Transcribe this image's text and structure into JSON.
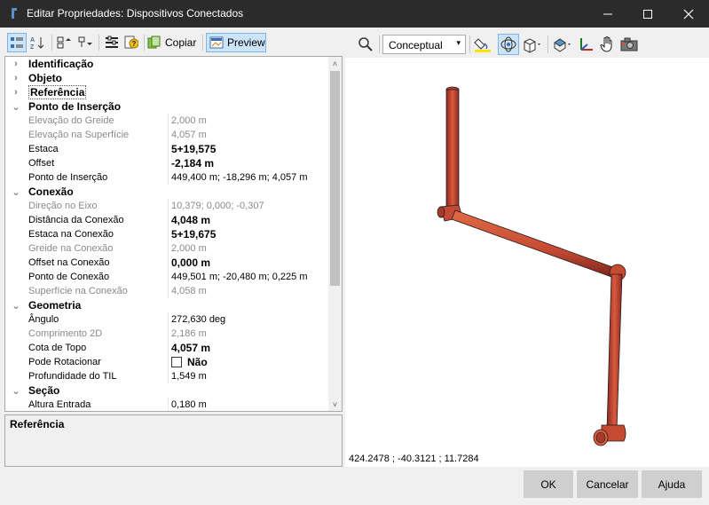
{
  "window": {
    "title": "Editar Propriedades: Dispositivos Conectados",
    "minimize_icon": "minimize-icon",
    "maximize_icon": "maximize-icon",
    "close_icon": "close-icon"
  },
  "toolbar_left": {
    "copy_label": "Copiar",
    "preview_label": "Preview"
  },
  "properties": {
    "categories": {
      "identificacao": "Identificação",
      "objeto": "Objeto",
      "referencia": "Referência",
      "ponto_insercao": "Ponto de Inserção",
      "conexao": "Conexão",
      "geometria": "Geometria",
      "secao": "Seção"
    },
    "ponto_insercao": [
      {
        "name": "Elevação do Greide",
        "value": "2,000 m"
      },
      {
        "name": "Elevação na Superfície",
        "value": "4,057 m"
      },
      {
        "name": "Estaca",
        "value": "5+19,575"
      },
      {
        "name": "Offset",
        "value": "-2,184 m"
      },
      {
        "name": "Ponto de Inserção",
        "value": "449,400 m; -18,296 m; 4,057 m"
      }
    ],
    "conexao": [
      {
        "name": "Direção no Eixo",
        "value": "10,379; 0,000; -0,307"
      },
      {
        "name": "Distância da Conexão",
        "value": "4,048 m"
      },
      {
        "name": "Estaca na Conexão",
        "value": "5+19,675"
      },
      {
        "name": "Greide na Conexão",
        "value": "2,000 m"
      },
      {
        "name": "Offset na Conexão",
        "value": "0,000 m"
      },
      {
        "name": "Ponto de Conexão",
        "value": "449,501 m; -20,480 m; 0,225 m"
      },
      {
        "name": "Superfície na Conexão",
        "value": "4,058 m"
      }
    ],
    "geometria": [
      {
        "name": "Ângulo",
        "value": "272,630 deg"
      },
      {
        "name": "Comprimento 2D",
        "value": "2,186 m"
      },
      {
        "name": "Cota de Topo",
        "value": "4,057 m"
      },
      {
        "name": "Pode Rotacionar",
        "value": "Não"
      },
      {
        "name": "Profundidade do TIL",
        "value": "1,549 m"
      }
    ],
    "secao": [
      {
        "name": "Altura Entrada",
        "value": "0,180 m"
      }
    ]
  },
  "description": {
    "title": "Referência"
  },
  "toolbar_right": {
    "visual_style": "Conceptual"
  },
  "viewport": {
    "coordinates": "424.2478 ; -40.3121 ; 11.7284",
    "pipe_color": "#d2553a"
  },
  "buttons": {
    "ok": "OK",
    "cancel": "Cancelar",
    "help": "Ajuda"
  }
}
